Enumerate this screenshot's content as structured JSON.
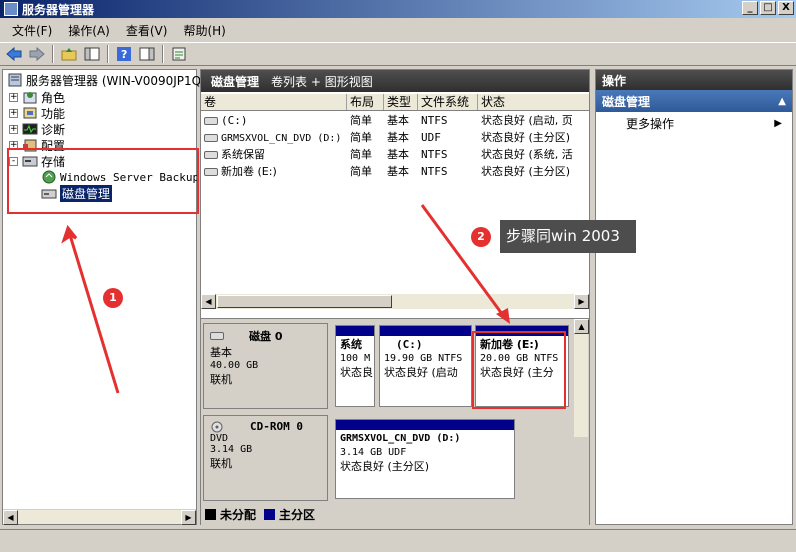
{
  "window": {
    "title": "服务器管理器",
    "min": "_",
    "max": "□",
    "close": "X"
  },
  "menu": [
    "文件(F)",
    "操作(A)",
    "查看(V)",
    "帮助(H)"
  ],
  "tree": {
    "root": "服务器管理器 (WIN-V0090JP1QL",
    "items": [
      {
        "label": "角色",
        "icon": "roles-icon"
      },
      {
        "label": "功能",
        "icon": "features-icon"
      },
      {
        "label": "诊断",
        "icon": "diagnostics-icon"
      },
      {
        "label": "配置",
        "icon": "configuration-icon"
      },
      {
        "label": "存储",
        "icon": "storage-icon"
      }
    ],
    "storage_children": [
      "Windows Server Backup",
      "磁盘管理"
    ]
  },
  "center": {
    "title": "磁盘管理",
    "subtitle": "卷列表 + 图形视图",
    "columns": [
      "卷",
      "布局",
      "类型",
      "文件系统",
      "状态"
    ],
    "volumes": [
      {
        "name": "(C:)",
        "layout": "简单",
        "type": "基本",
        "fs": "NTFS",
        "status": "状态良好 (启动, 页"
      },
      {
        "name": "GRMSXVOL_CN_DVD (D:)",
        "layout": "简单",
        "type": "基本",
        "fs": "UDF",
        "status": "状态良好 (主分区)"
      },
      {
        "name": "系统保留",
        "layout": "简单",
        "type": "基本",
        "fs": "NTFS",
        "status": "状态良好 (系统, 活"
      },
      {
        "name": "新加卷 (E:)",
        "layout": "简单",
        "type": "基本",
        "fs": "NTFS",
        "status": "状态良好 (主分区)"
      }
    ],
    "disk0": {
      "name": "磁盘 0",
      "type": "基本",
      "size": "40.00 GB",
      "state": "联机",
      "parts": [
        {
          "l1": "系统",
          "l2": "100 M",
          "l3": "状态良"
        },
        {
          "l1": "(C:)",
          "l2": "19.90 GB NTFS",
          "l3": "状态良好 (启动"
        },
        {
          "l1": "新加卷  (E:)",
          "l2": "20.00 GB NTFS",
          "l3": "状态良好 (主分"
        }
      ]
    },
    "cdrom": {
      "name": "CD-ROM 0",
      "type": "DVD",
      "size": "3.14 GB",
      "state": "联机",
      "part": {
        "l1": "GRMSXVOL_CN_DVD   (D:)",
        "l2": "3.14 GB UDF",
        "l3": "状态良好 (主分区)"
      }
    },
    "legend": [
      {
        "label": "未分配",
        "color": "#000000"
      },
      {
        "label": "主分区",
        "color": "#00008b"
      }
    ]
  },
  "actions": {
    "header": "操作",
    "section": "磁盘管理",
    "more": "更多操作"
  },
  "annotations": {
    "badge1": "1",
    "badge2": "2",
    "tooltip": "步骤同win 2003",
    "color": "#e53030"
  }
}
